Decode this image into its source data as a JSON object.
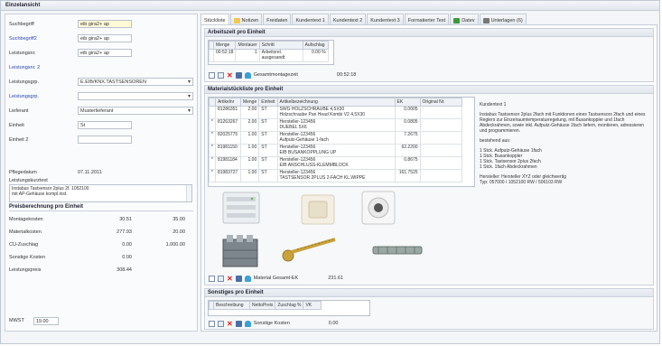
{
  "window": {
    "title": "Einzelansicht"
  },
  "left": {
    "fields": [
      {
        "label": "Suchbegriff",
        "value": "eib gira2+ ap",
        "blue": false,
        "hl": true,
        "combo": false
      },
      {
        "label": "Suchbegriff2",
        "value": "eib gira2+ ap",
        "blue": true,
        "hl": false,
        "combo": false
      },
      {
        "label": "Leistungsnr.",
        "value": "eib gira2+ ap",
        "blue": false,
        "hl": false,
        "combo": false
      },
      {
        "label": "Leistungsnr. 2",
        "value": "",
        "blue": true,
        "hl": false,
        "combo": false,
        "nofield": true
      },
      {
        "label": "Leistungsgrp.",
        "value": "E.EIB/KNX.TASTSENSOREN",
        "blue": false,
        "hl": false,
        "combo": true
      },
      {
        "label": "Leistungsgrp.",
        "value": "",
        "blue": true,
        "hl": false,
        "combo": true
      },
      {
        "label": "Lieferant",
        "value": "Musterlieferant",
        "blue": false,
        "hl": false,
        "combo": true
      },
      {
        "label": "Einheit",
        "value": "St",
        "blue": false,
        "hl": false,
        "combo": false
      },
      {
        "label": "Einheit 2",
        "value": "",
        "blue": false,
        "hl": false,
        "combo": false
      }
    ],
    "pflegedatum_label": "Pflegedatum",
    "pflegedatum_value": "07.11.2011",
    "kurztext_label": "Leistungskurztext",
    "kurztext": "Instabus Tastsensor 2plus 2f. 1052100\nmit AP-Gehäuse kompl.inst.",
    "preis_title": "Preisberechnung pro Einheit",
    "preis_rows": [
      {
        "label": "Montagekosten",
        "v1": "30.51",
        "v2": "35.00"
      },
      {
        "label": "Materialkosten",
        "v1": "277.93",
        "v2": "20.00"
      },
      {
        "label": "CU-Zuschlag",
        "v1": "0.00",
        "v2": "1.000.00"
      },
      {
        "label": "Sonstige Kosten",
        "v1": "0.00",
        "v2": ""
      },
      {
        "label": "Leistungspreis",
        "v1": "308.44",
        "v2": ""
      }
    ],
    "mwst_label": "MWST",
    "mwst_value": "19.00"
  },
  "tabs": [
    {
      "label": "Stückliste",
      "active": true,
      "icon": ""
    },
    {
      "label": "Notizen",
      "active": false,
      "icon": "note-icon",
      "color": "#f2c94c"
    },
    {
      "label": "Freidaten",
      "active": false,
      "icon": ""
    },
    {
      "label": "Kundentext 1",
      "active": false,
      "icon": ""
    },
    {
      "label": "Kundentext 2",
      "active": false,
      "icon": ""
    },
    {
      "label": "Kundentext 3",
      "active": false,
      "icon": ""
    },
    {
      "label": "Formatierter Text",
      "active": false,
      "icon": ""
    },
    {
      "label": "Datev",
      "active": false,
      "icon": "datev-icon",
      "color": "#3a9a3a"
    },
    {
      "label": "Unterlagen (6)",
      "active": false,
      "icon": "paperclip-icon",
      "color": "#777"
    }
  ],
  "arbeitszeit": {
    "title": "Arbeitszeit pro Einheit",
    "columns": [
      "",
      "Menge",
      "Montauer",
      "Schritt",
      "Aufschlag"
    ],
    "rows": [
      [
        "",
        "00:52:18",
        "1",
        "Arbeitsrel. ausgesandt",
        "0.00 %"
      ]
    ],
    "total_label": "Gesamtmontagezeit",
    "total_value": "00:52:18"
  },
  "material": {
    "title": "Materialstückliste pro Einheit",
    "columns": [
      "",
      "Artikelnr",
      "Menge",
      "Einheit",
      "Artikelbezeichnung",
      "EK",
      "Original Nr."
    ],
    "rows": [
      [
        "",
        "81286351",
        "2.00",
        "ST",
        "SWG HOLZSCHRAUBE 4,5X30\nHolzschraube Pan Head Kombi V2 4,5X30",
        "0.0005",
        ""
      ],
      [
        "*",
        "81263267",
        "2.00",
        "ST",
        "Hersteller-123456\nDUEBEL 5X6",
        "0.0805",
        ""
      ],
      [
        "*",
        "82025775",
        "1.00",
        "ST",
        "Hersteller-123456\nAufputz-Gehäuse 1-fach",
        "7.2675",
        ""
      ],
      [
        "*",
        "81981150",
        "1.00",
        "ST",
        "Hersteller-123456\nEIB BUSANKOPPLUNG UP",
        "62.2200",
        ""
      ],
      [
        "*",
        "81981184",
        "1.00",
        "ST",
        "Hersteller-123456\nEIB ANSCHLUSS-KLEMMBLOCK",
        "0.8675",
        ""
      ],
      [
        "*",
        "81983727",
        "1.00",
        "ST",
        "Hersteller-123456\nTASTSENSOR 2PLUS 2-FACH KL.WIPPE",
        "161.7525",
        ""
      ]
    ],
    "total_label": "Material Gesamt-EK",
    "total_value": "231.61",
    "description": [
      "Kundentext 1",
      "Instabus Tastsensor 2plus 2fach mit Funktionen eines Tastsensors 2fach und eines Reglers zur Einzelraumtemperaturregelung, mit Busankoppler und 1fach Abdeckrahmen, sowie inkl. Aufputz-Gehäuse 1fach liefern, montieren, adressieren und programmieren.",
      "bestehend aus:",
      "1 Stck. Aufputz-Gehäuse 1fach\n1 Stck. Busankoppler\n1 Stck. Tastsensor 2plus 2fach\n1 Stck. 1fach Abdeckrahmen",
      "Hersteller: Hersteller XYZ oder gleichwertig\nTyp: 057000 / 1052100 RW / 506103 RW"
    ]
  },
  "sonstiges": {
    "title": "Sonstiges pro Einheit",
    "columns": [
      "",
      "Beschreibung",
      "NettoPreis",
      "Zuschlag %",
      "VK"
    ],
    "total_label": "Sonstige Kosten",
    "total_value": "0.00"
  }
}
